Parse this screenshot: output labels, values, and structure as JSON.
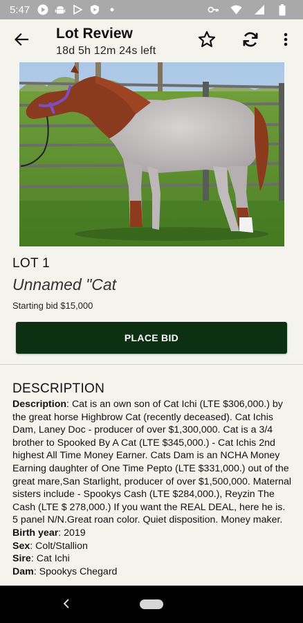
{
  "status_bar": {
    "time": "5:47"
  },
  "header": {
    "title": "Lot Review",
    "countdown": "18d 5h 12m 24s left"
  },
  "lot": {
    "number": "LOT 1",
    "name": "Unnamed \"Cat",
    "starting_bid": "Starting bid $15,000"
  },
  "actions": {
    "place_bid": "PLACE BID"
  },
  "description": {
    "heading": "DESCRIPTION",
    "fields": [
      {
        "label": "Description",
        "sep": ": ",
        "value": "Cat is an own son of Cat Ichi (LTE $306,000.) by the great horse Highbrow Cat (recently deceased). Cat Ichis Dam, Laney Doc - producer of over $1,300,000. Cat is a 3/4 brother to Spooked By A Cat (LTE $345,000.) - Cat Ichis 2nd highest All Time Money Earner. Cats Dam is an NCHA Money Earning daughter of One Time Pepto (LTE $331,000.) out of the great mare,San Starlight, producer of over $1,500,000. Maternal sisters include - Spookys Cash (LTE $284,000.), Reyzin The Cash (LTE $ 278,000.) If you want the REAL DEAL, here he is. 5 panel N/N.Great roan color. Quiet disposition. Money maker."
      },
      {
        "label": "Birth year",
        "sep": ": ",
        "value": "2019"
      },
      {
        "label": "Sex",
        "sep": ": ",
        "value": "Colt/Stallion"
      },
      {
        "label": "Sire",
        "sep": ": ",
        "value": "Cat Ichi"
      },
      {
        "label": "Dam",
        "sep": ": ",
        "value": "Spookys Chegard"
      }
    ]
  },
  "icons": {
    "back": "arrow-left-icon",
    "favorite": "star-outline-icon",
    "refresh": "refresh-icon",
    "menu": "more-vertical-icon"
  },
  "colors": {
    "primary_button": "#0b3112",
    "status_bar": "#a9a9a9",
    "background": "#f5f3ee"
  }
}
